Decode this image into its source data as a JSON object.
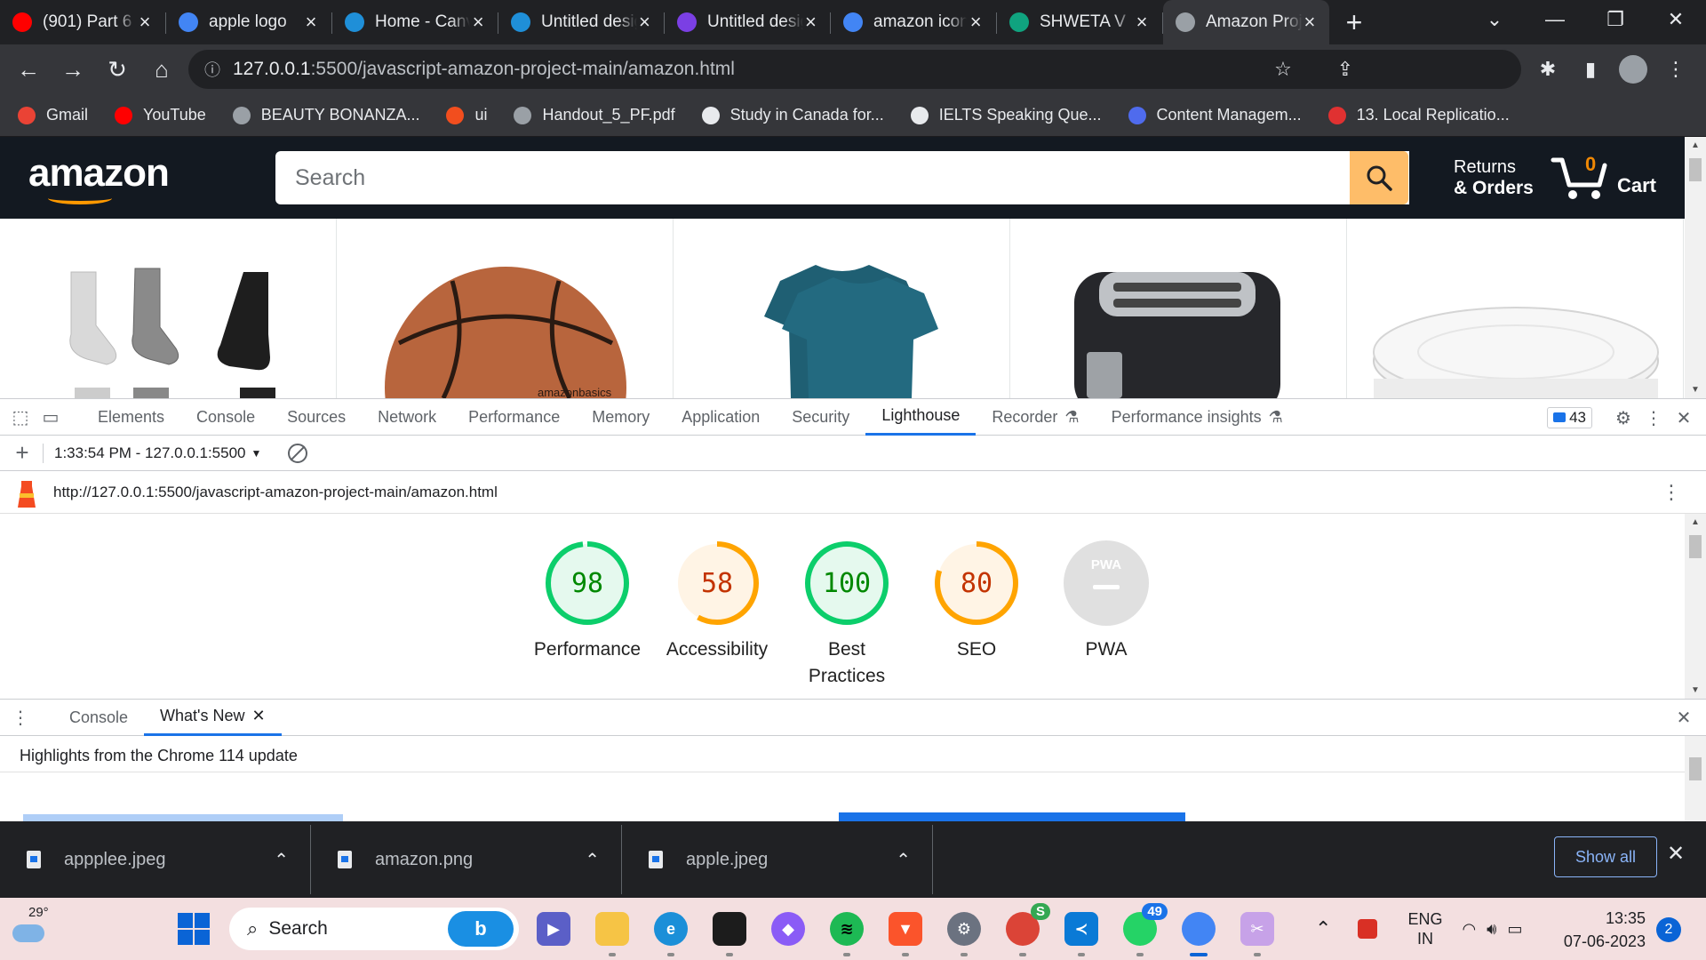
{
  "browser": {
    "tabs": [
      {
        "title": "(901) Part 6",
        "favicon": "youtube-icon",
        "color": "#ff0000"
      },
      {
        "title": "apple logo",
        "favicon": "google-icon",
        "color": "#4285f4"
      },
      {
        "title": "Home - Canva",
        "favicon": "canva-icon",
        "color": "#1f8fd8"
      },
      {
        "title": "Untitled design",
        "favicon": "canva-icon",
        "color": "#1f8fd8"
      },
      {
        "title": "Untitled design",
        "favicon": "heart-app-icon",
        "color": "#7b3fe4"
      },
      {
        "title": "amazon icon",
        "favicon": "google-icon",
        "color": "#4285f4"
      },
      {
        "title": "SHWETA V",
        "favicon": "chatgpt-icon",
        "color": "#10a37f"
      },
      {
        "title": "Amazon Project",
        "favicon": "globe-icon",
        "color": "#9aa0a6"
      }
    ],
    "new_tab": "+",
    "address": {
      "host": "127.0.0.1",
      "path": ":5500/javascript-amazon-project-main/amazon.html"
    },
    "bookmarks": [
      {
        "label": "Gmail",
        "color": "#ea4335"
      },
      {
        "label": "YouTube",
        "color": "#ff0000"
      },
      {
        "label": "BEAUTY BONANZA...",
        "color": "#9aa0a6"
      },
      {
        "label": "ui",
        "color": "#f24e1e"
      },
      {
        "label": "Handout_5_PF.pdf",
        "color": "#9aa0a6"
      },
      {
        "label": "Study in Canada for...",
        "color": "#e8eaed"
      },
      {
        "label": "IELTS Speaking Que...",
        "color": "#e8eaed"
      },
      {
        "label": "Content Managem...",
        "color": "#4f6bed"
      },
      {
        "label": "13. Local Replicatio...",
        "color": "#e03131"
      }
    ]
  },
  "amazon": {
    "logo": "amazon",
    "search_placeholder": "Search",
    "returns_line1": "Returns",
    "returns_line2": "& Orders",
    "cart_qty": "0",
    "cart_label": "Cart",
    "products": [
      "socks",
      "basketball",
      "t-shirt",
      "toaster",
      "plates"
    ],
    "product_text": "amazonbasics"
  },
  "devtools": {
    "tabs": [
      "Elements",
      "Console",
      "Sources",
      "Network",
      "Performance",
      "Memory",
      "Application",
      "Security",
      "Lighthouse",
      "Recorder",
      "Performance insights"
    ],
    "active_tab": "Lighthouse",
    "issues_count": "43",
    "report_time": "1:33:54 PM - 127.0.0.1:5500",
    "report_url": "http://127.0.0.1:5500/javascript-amazon-project-main/amazon.html",
    "scores": [
      {
        "value": "98",
        "label": "Performance",
        "fraction": 0.98,
        "color": "#0cce6b",
        "text_color": "#008800",
        "bg": "#e5f9ee"
      },
      {
        "value": "58",
        "label": "Accessibility",
        "fraction": 0.58,
        "color": "#ffa400",
        "text_color": "#c33300",
        "bg": "#fff4e5"
      },
      {
        "value": "100",
        "label": "Best\nPractices",
        "fraction": 1.0,
        "color": "#0cce6b",
        "text_color": "#008800",
        "bg": "#e5f9ee"
      },
      {
        "value": "80",
        "label": "SEO",
        "fraction": 0.8,
        "color": "#ffa400",
        "text_color": "#c33300",
        "bg": "#fff4e5"
      }
    ],
    "pwa": {
      "label": "PWA",
      "badge": "PWA"
    },
    "drawer_tabs": [
      "Console",
      "What's New"
    ],
    "drawer_active": "What's New",
    "highlights": "Highlights from the Chrome 114 update"
  },
  "downloads": {
    "items": [
      "appplee.jpeg",
      "amazon.png",
      "apple.jpeg"
    ],
    "show_all": "Show all"
  },
  "taskbar": {
    "weather": "29°",
    "search": "Search",
    "whatsapp_badge": "49",
    "chrome_badge": "S",
    "lang_line1": "ENG",
    "lang_line2": "IN",
    "time": "13:35",
    "date": "07-06-2023",
    "notifications": "2"
  }
}
